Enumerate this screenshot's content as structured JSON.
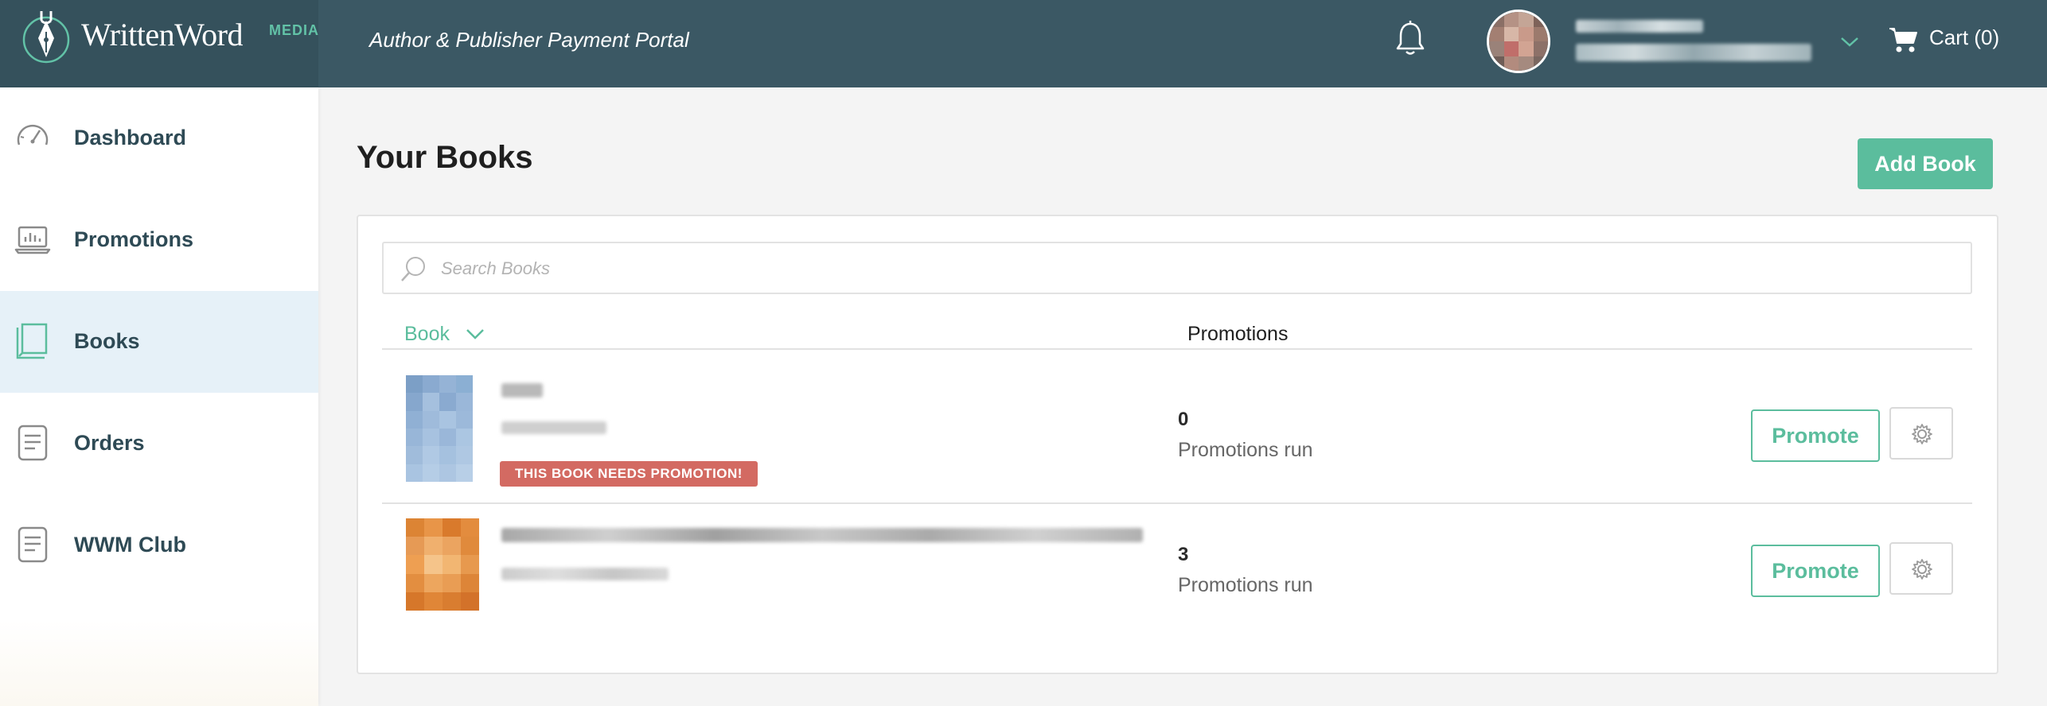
{
  "header": {
    "logo_text": "WrittenWord",
    "logo_suffix": "MEDIA",
    "portal_title": "Author & Publisher Payment Portal",
    "cart_label": "Cart (0)",
    "icons": [
      "bell-icon",
      "chevron-down-icon",
      "cart-icon"
    ]
  },
  "sidebar": {
    "items": [
      {
        "label": "Dashboard",
        "icon": "speedometer-icon"
      },
      {
        "label": "Promotions",
        "icon": "laptop-chart-icon"
      },
      {
        "label": "Books",
        "icon": "book-icon",
        "active": true
      },
      {
        "label": "Orders",
        "icon": "document-icon"
      },
      {
        "label": "WWM Club",
        "icon": "document-icon"
      }
    ]
  },
  "main": {
    "title": "Your Books",
    "add_button": "Add Book",
    "search_placeholder": "Search Books",
    "columns": {
      "book": "Book",
      "promotions": "Promotions"
    },
    "books": [
      {
        "badge": "THIS BOOK NEEDS PROMOTION!",
        "promotions_count": "0",
        "promotions_label": "Promotions run",
        "promote_label": "Promote"
      },
      {
        "promotions_count": "3",
        "promotions_label": "Promotions run",
        "promote_label": "Promote"
      }
    ]
  },
  "colors": {
    "header_bg": "#3b5864",
    "accent_green": "#5bbd9d",
    "badge_red": "#d36a62",
    "active_nav_bg": "#e6f1f8"
  }
}
